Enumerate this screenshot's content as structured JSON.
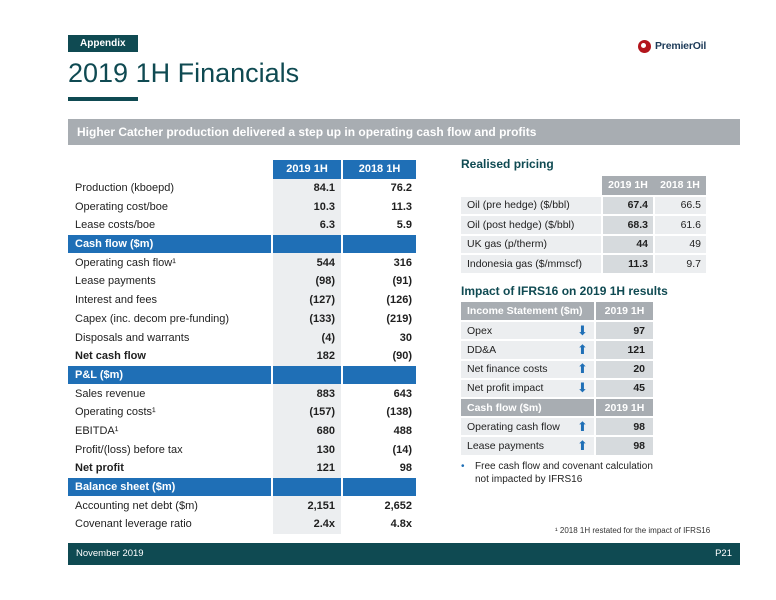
{
  "header": {
    "tag": "Appendix",
    "logo_text": "PremierOil",
    "title": "2019 1H Financials",
    "banner": "Higher Catcher production delivered a step up in operating cash flow and profits"
  },
  "financials": {
    "col1": "2019 1H",
    "col2": "2018 1H",
    "rows": [
      {
        "label": "Production (kboepd)",
        "v1": "84.1",
        "v2": "76.2"
      },
      {
        "label": "Operating cost/boe",
        "v1": "10.3",
        "v2": "11.3"
      },
      {
        "label": "Lease costs/boe",
        "v1": "6.3",
        "v2": "5.9"
      },
      {
        "label": "Cash flow ($m)"
      },
      {
        "label": "Operating cash flow¹",
        "v1": "544",
        "v2": "316"
      },
      {
        "label": "Lease payments",
        "v1": "(98)",
        "v2": "(91)"
      },
      {
        "label": "Interest and fees",
        "v1": "(127)",
        "v2": "(126)"
      },
      {
        "label": "Capex (inc. decom pre-funding)",
        "v1": "(133)",
        "v2": "(219)"
      },
      {
        "label": "Disposals and warrants",
        "v1": "(4)",
        "v2": "30"
      },
      {
        "label": "Net cash flow",
        "v1": "182",
        "v2": "(90)"
      },
      {
        "label": "P&L ($m)"
      },
      {
        "label": "Sales revenue",
        "v1": "883",
        "v2": "643"
      },
      {
        "label": "Operating costs¹",
        "v1": "(157)",
        "v2": "(138)"
      },
      {
        "label": "EBITDA¹",
        "v1": "680",
        "v2": "488"
      },
      {
        "label": "Profit/(loss) before tax",
        "v1": "130",
        "v2": "(14)"
      },
      {
        "label": "Net profit",
        "v1": "121",
        "v2": "98"
      },
      {
        "label": "Balance sheet ($m)"
      },
      {
        "label": "Accounting net debt ($m)",
        "v1": "2,151",
        "v2": "2,652"
      },
      {
        "label": "Covenant leverage ratio",
        "v1": "2.4x",
        "v2": "4.8x"
      }
    ]
  },
  "realised_pricing": {
    "title": "Realised pricing",
    "col1": "2019 1H",
    "col2": "2018 1H",
    "rows": [
      {
        "label": "Oil (pre hedge) ($/bbl)",
        "v1": "67.4",
        "v2": "66.5"
      },
      {
        "label": "Oil (post hedge) ($/bbl)",
        "v1": "68.3",
        "v2": "61.6"
      },
      {
        "label": "UK gas (p/therm)",
        "v1": "44",
        "v2": "49"
      },
      {
        "label": "Indonesia gas ($/mmscf)",
        "v1": "11.3",
        "v2": "9.7"
      }
    ]
  },
  "ifrs16": {
    "title": "Impact of IFRS16 on 2019 1H results",
    "income_header": "Income Statement ($m)",
    "income_col": "2019 1H",
    "income_rows": [
      {
        "label": "Opex",
        "dir": "down",
        "value": "97"
      },
      {
        "label": "DD&A",
        "dir": "up",
        "value": "121"
      },
      {
        "label": "Net finance costs",
        "dir": "up",
        "value": "20"
      },
      {
        "label": "Net profit impact",
        "dir": "down",
        "value": "45"
      }
    ],
    "cash_header": "Cash flow ($m)",
    "cash_col": "2019 1H",
    "cash_rows": [
      {
        "label": "Operating cash flow",
        "dir": "up",
        "value": "98"
      },
      {
        "label": "Lease payments",
        "dir": "up",
        "value": "98"
      }
    ],
    "bullet": "Free cash flow and covenant calculation not impacted by IFRS16"
  },
  "footnote": "¹ 2018 1H restated for the impact of IFRS16",
  "footer": {
    "date": "November 2019",
    "page": "P21"
  },
  "colors": {
    "teal": "#0f4a52",
    "blue": "#1f6fb6",
    "grey_banner": "#a8adb2",
    "logo_red": "#b3151c"
  },
  "icons": {
    "up": "arrow-up-icon",
    "down": "arrow-down-icon"
  }
}
